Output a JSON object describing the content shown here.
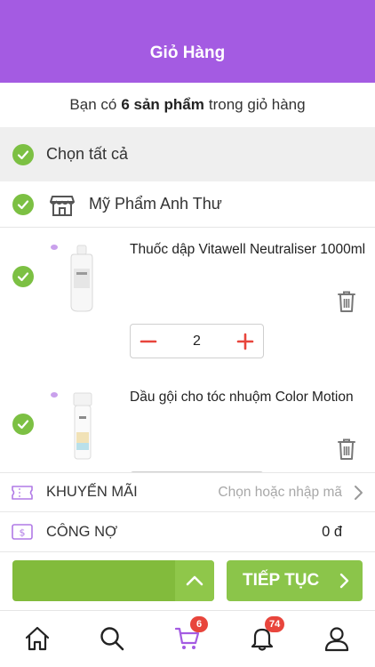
{
  "header": {
    "title": "Giỏ Hàng"
  },
  "summary": {
    "prefix": "Bạn có",
    "count": "6 sản phẩm",
    "suffix": "trong giỏ hàng"
  },
  "select_all": {
    "label": "Chọn tất cả",
    "checked": true
  },
  "shop": {
    "name": "Mỹ Phẩm Anh Thư",
    "checked": true
  },
  "products": [
    {
      "name": "Thuốc dập Vitawell Neutraliser 1000ml",
      "quantity": "2",
      "checked": true
    },
    {
      "name": "Dầu gội cho tóc nhuộm Color Motion",
      "checked": true
    }
  ],
  "promotion": {
    "label": "KHUYẾN MÃI",
    "hint": "Chọn hoặc nhập mã"
  },
  "debt": {
    "label": "CÔNG NỢ",
    "amount": "0 đ"
  },
  "actions": {
    "continue_label": "TIẾP TỤC"
  },
  "tabbar": {
    "items": [
      {
        "icon": "home-icon"
      },
      {
        "icon": "search-icon"
      },
      {
        "icon": "cart-icon",
        "badge": "6"
      },
      {
        "icon": "bell-icon",
        "badge": "74"
      },
      {
        "icon": "user-icon"
      }
    ]
  },
  "colors": {
    "brand": "#a45be2",
    "accent_green": "#82bb3c",
    "check_green": "#7cc043",
    "stepper_red": "#e8453c",
    "badge_red": "#e8453c"
  }
}
